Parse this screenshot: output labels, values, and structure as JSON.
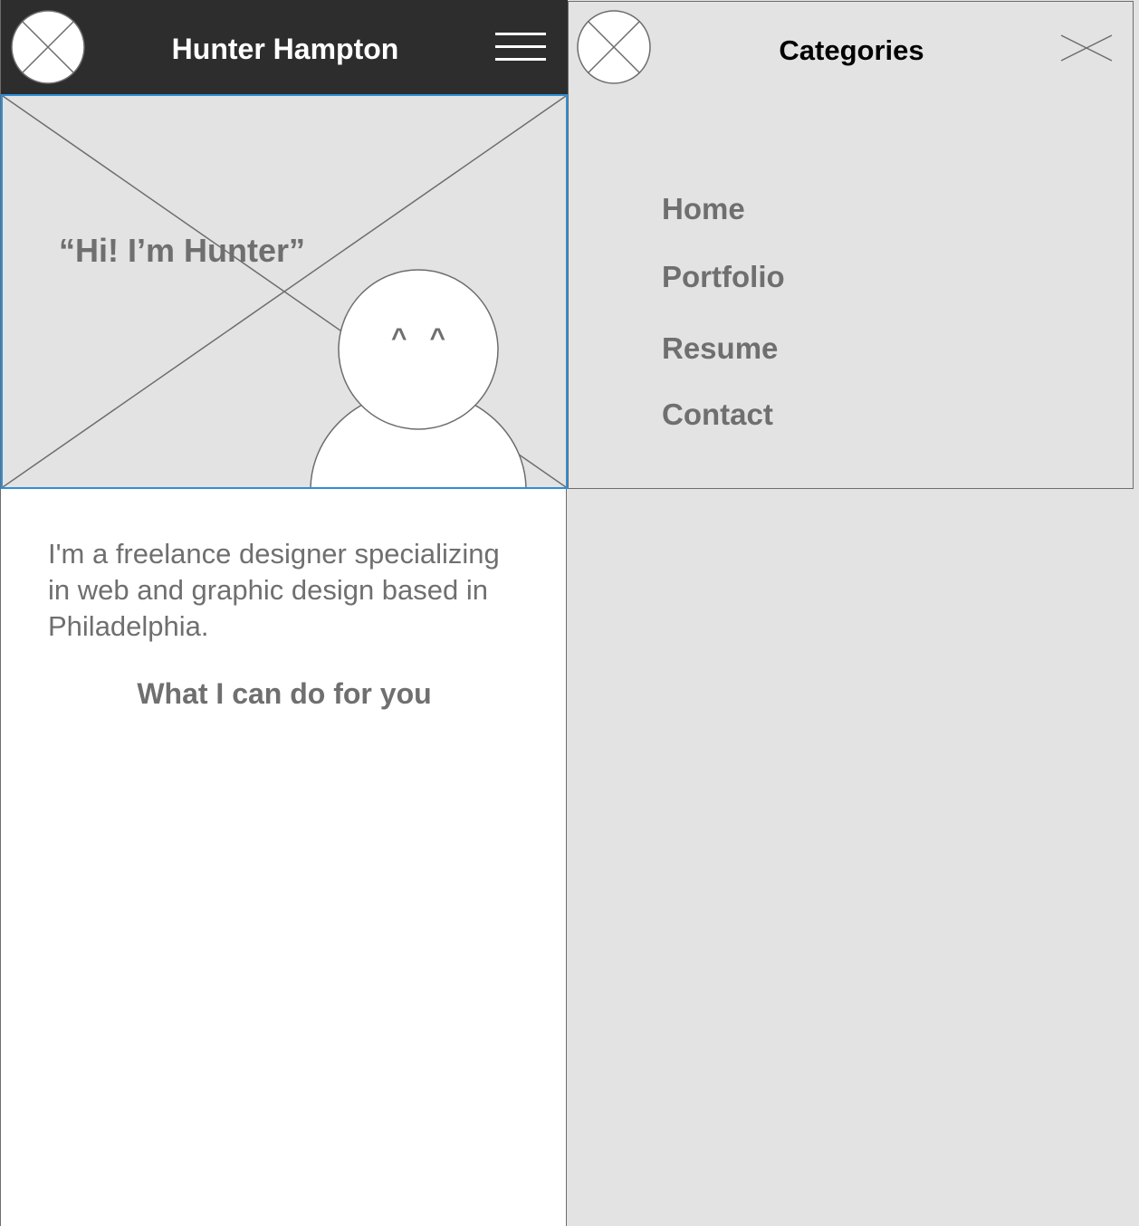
{
  "header": {
    "title": "Hunter Hampton",
    "logo_icon": "image-placeholder-icon",
    "menu_icon": "hamburger-menu-icon",
    "background": "#2d2d2d"
  },
  "hero": {
    "quote": "“Hi! I’m Hunter”",
    "avatar_eyes": "^   ^",
    "border_color": "#2f8fd8"
  },
  "intro": {
    "text": "I'm a freelance designer specializing in web and graphic design based in Philadelphia."
  },
  "services": {
    "heading": "What I can do for you"
  },
  "menu": {
    "title": "Categories",
    "close_icon": "close-icon",
    "items": [
      {
        "label": "Home"
      },
      {
        "label": "Portfolio"
      },
      {
        "label": "Resume"
      },
      {
        "label": "Contact"
      }
    ]
  }
}
